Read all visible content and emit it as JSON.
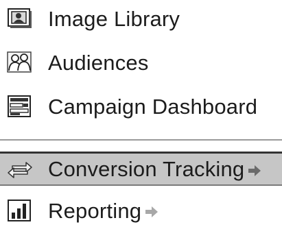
{
  "menu": {
    "items": [
      {
        "label": "Image Library",
        "icon": "image-library-icon"
      },
      {
        "label": "Audiences",
        "icon": "audiences-icon"
      },
      {
        "label": "Campaign Dashboard",
        "icon": "dashboard-icon"
      },
      {
        "label": "Conversion Tracking",
        "icon": "conversion-tracking-icon",
        "selected": true,
        "has_arrow": true
      },
      {
        "label": "Reporting",
        "icon": "reporting-icon",
        "has_arrow": true
      }
    ]
  },
  "colors": {
    "selected_background": "#c6c6c6",
    "text": "#1c1c1c",
    "arrow": "#9a9a9a"
  }
}
